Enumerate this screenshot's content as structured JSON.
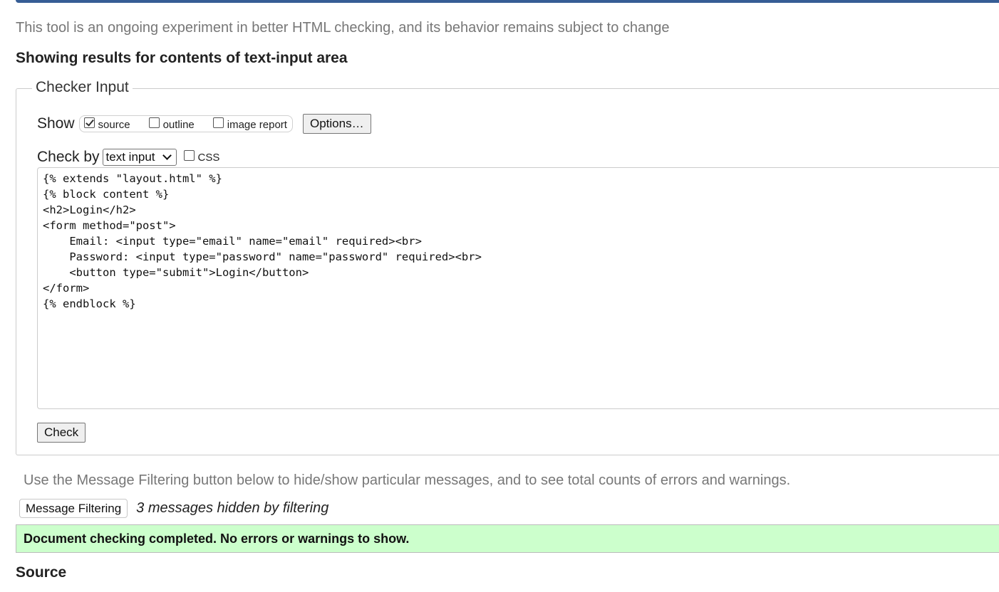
{
  "intro": "This tool is an ongoing experiment in better HTML checking, and its behavior remains subject to change",
  "results_heading": "Showing results for contents of text-input area",
  "checker": {
    "legend": "Checker Input",
    "show_label": "Show",
    "show_options": [
      {
        "label": "source",
        "checked": true
      },
      {
        "label": "outline",
        "checked": false
      },
      {
        "label": "image report",
        "checked": false
      }
    ],
    "options_button": "Options…",
    "check_by_label": "Check by",
    "check_by_value": "text input",
    "css_label": "CSS",
    "css_checked": false,
    "textarea_value": "{% extends \"layout.html\" %}\n{% block content %}\n<h2>Login</h2>\n<form method=\"post\">\n    Email: <input type=\"email\" name=\"email\" required><br>\n    Password: <input type=\"password\" name=\"password\" required><br>\n    <button type=\"submit\">Login</button>\n</form>\n{% endblock %}",
    "check_button": "Check"
  },
  "filter": {
    "note": "Use the Message Filtering button below to hide/show particular messages, and to see total counts of errors and warnings.",
    "button": "Message Filtering",
    "hidden_count": "3 messages hidden by filtering"
  },
  "result_message": "Document checking completed. No errors or warnings to show.",
  "source_heading": "Source",
  "colors": {
    "top_bar": "#365d95",
    "success_bg": "#ccffcc",
    "muted_text": "#777777"
  }
}
